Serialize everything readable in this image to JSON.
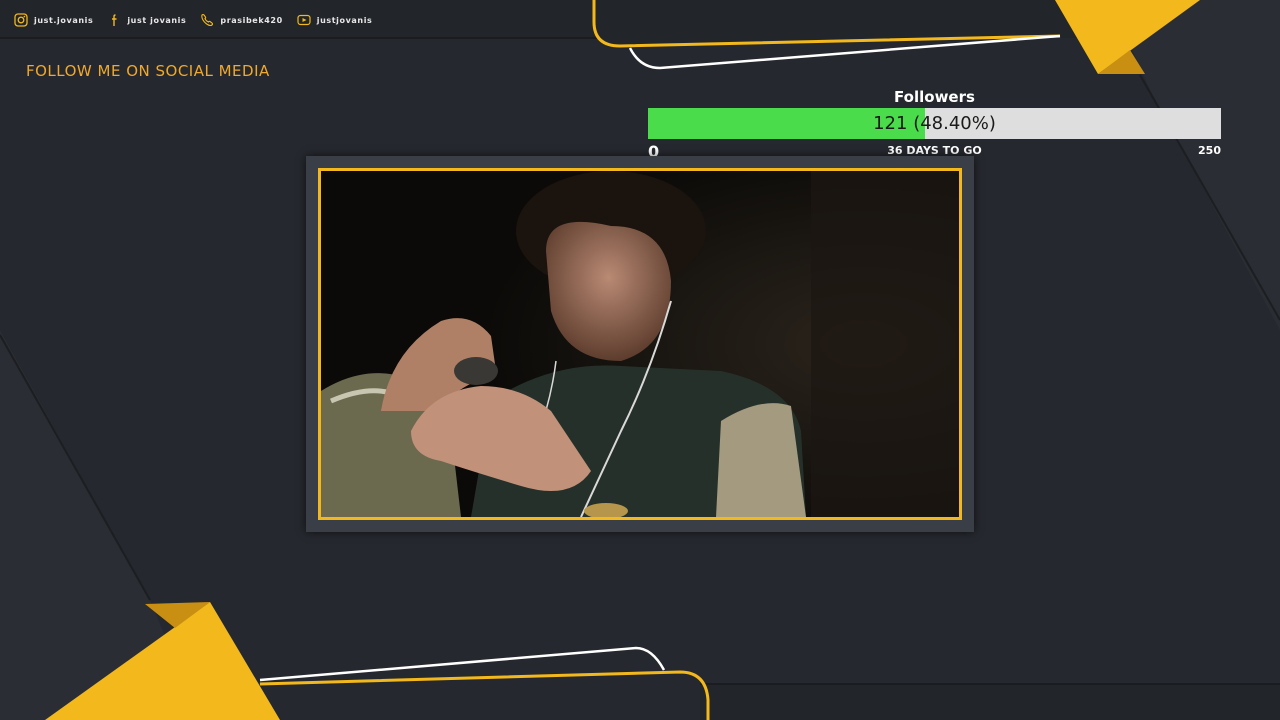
{
  "social": [
    {
      "icon": "instagram-icon",
      "label": "just.jovanis"
    },
    {
      "icon": "facebook-icon",
      "label": "just jovanis"
    },
    {
      "icon": "discord-icon",
      "label": "prasibek420"
    },
    {
      "icon": "youtube-icon",
      "label": "justjovanis"
    }
  ],
  "heading": "FOLLOW ME ON SOCIAL MEDIA",
  "goal": {
    "title": "Followers",
    "progress_text": "121 (48.40%)",
    "progress_fraction": 0.484,
    "min": "0",
    "days_left": "36 DAYS TO GO",
    "max": "250"
  },
  "colors": {
    "accent": "#f2b81c",
    "background": "#25282e",
    "progress": "#4bdc4b"
  }
}
